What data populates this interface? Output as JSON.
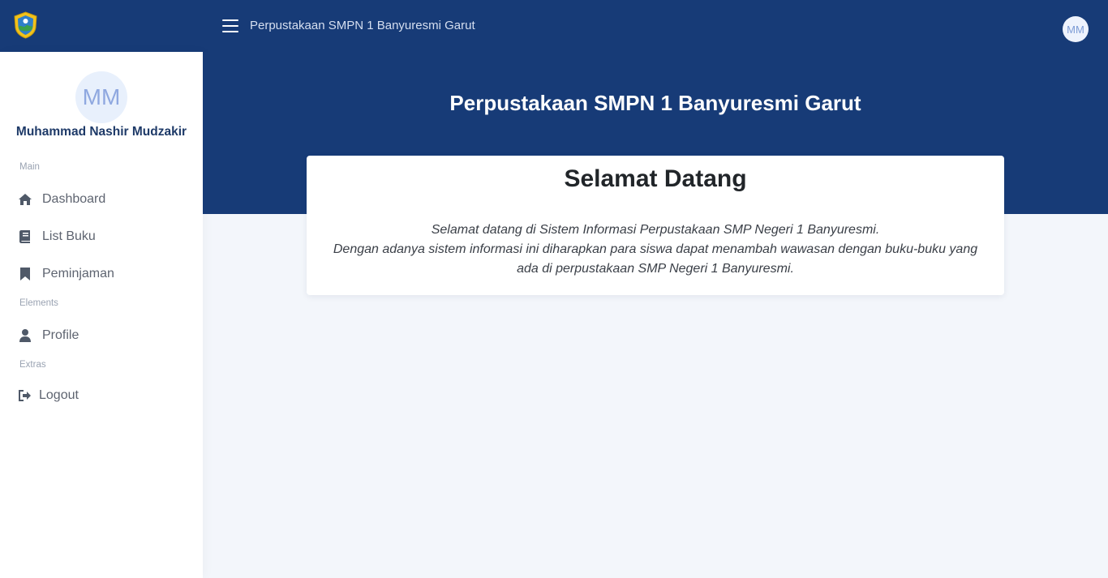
{
  "header": {
    "title": "Perpustakaan SMPN 1 Banyuresmi Garut",
    "avatar_initials": "MM"
  },
  "sidebar": {
    "avatar_initials": "MM",
    "user_name": "Muhammad Nashir Mudzakir",
    "sections": {
      "main": "Main",
      "elements": "Elements",
      "extras": "Extras"
    },
    "items": [
      {
        "label": "Dashboard",
        "icon": "home-icon"
      },
      {
        "label": "List Buku",
        "icon": "book-icon"
      },
      {
        "label": "Peminjaman",
        "icon": "bookmark-icon"
      },
      {
        "label": "Profile",
        "icon": "user-icon"
      },
      {
        "label": "Logout",
        "icon": "sign-out-icon"
      }
    ]
  },
  "main": {
    "hero_title": "Perpustakaan SMPN 1 Banyuresmi Garut",
    "card_title": "Selamat Datang",
    "card_line1": "Selamat datang di Sistem Informasi Perpustakaan SMP Negeri 1 Banyuresmi.",
    "card_line2": "Dengan adanya sistem informasi ini diharapkan para siswa dapat menambah wawasan dengan buku-buku yang ada di perpustakaan SMP Negeri 1 Banyuresmi."
  },
  "colors": {
    "primary": "#173b77",
    "background": "#f3f6fb",
    "sidebar_text": "#5e6470",
    "icon": "#4f5968"
  }
}
